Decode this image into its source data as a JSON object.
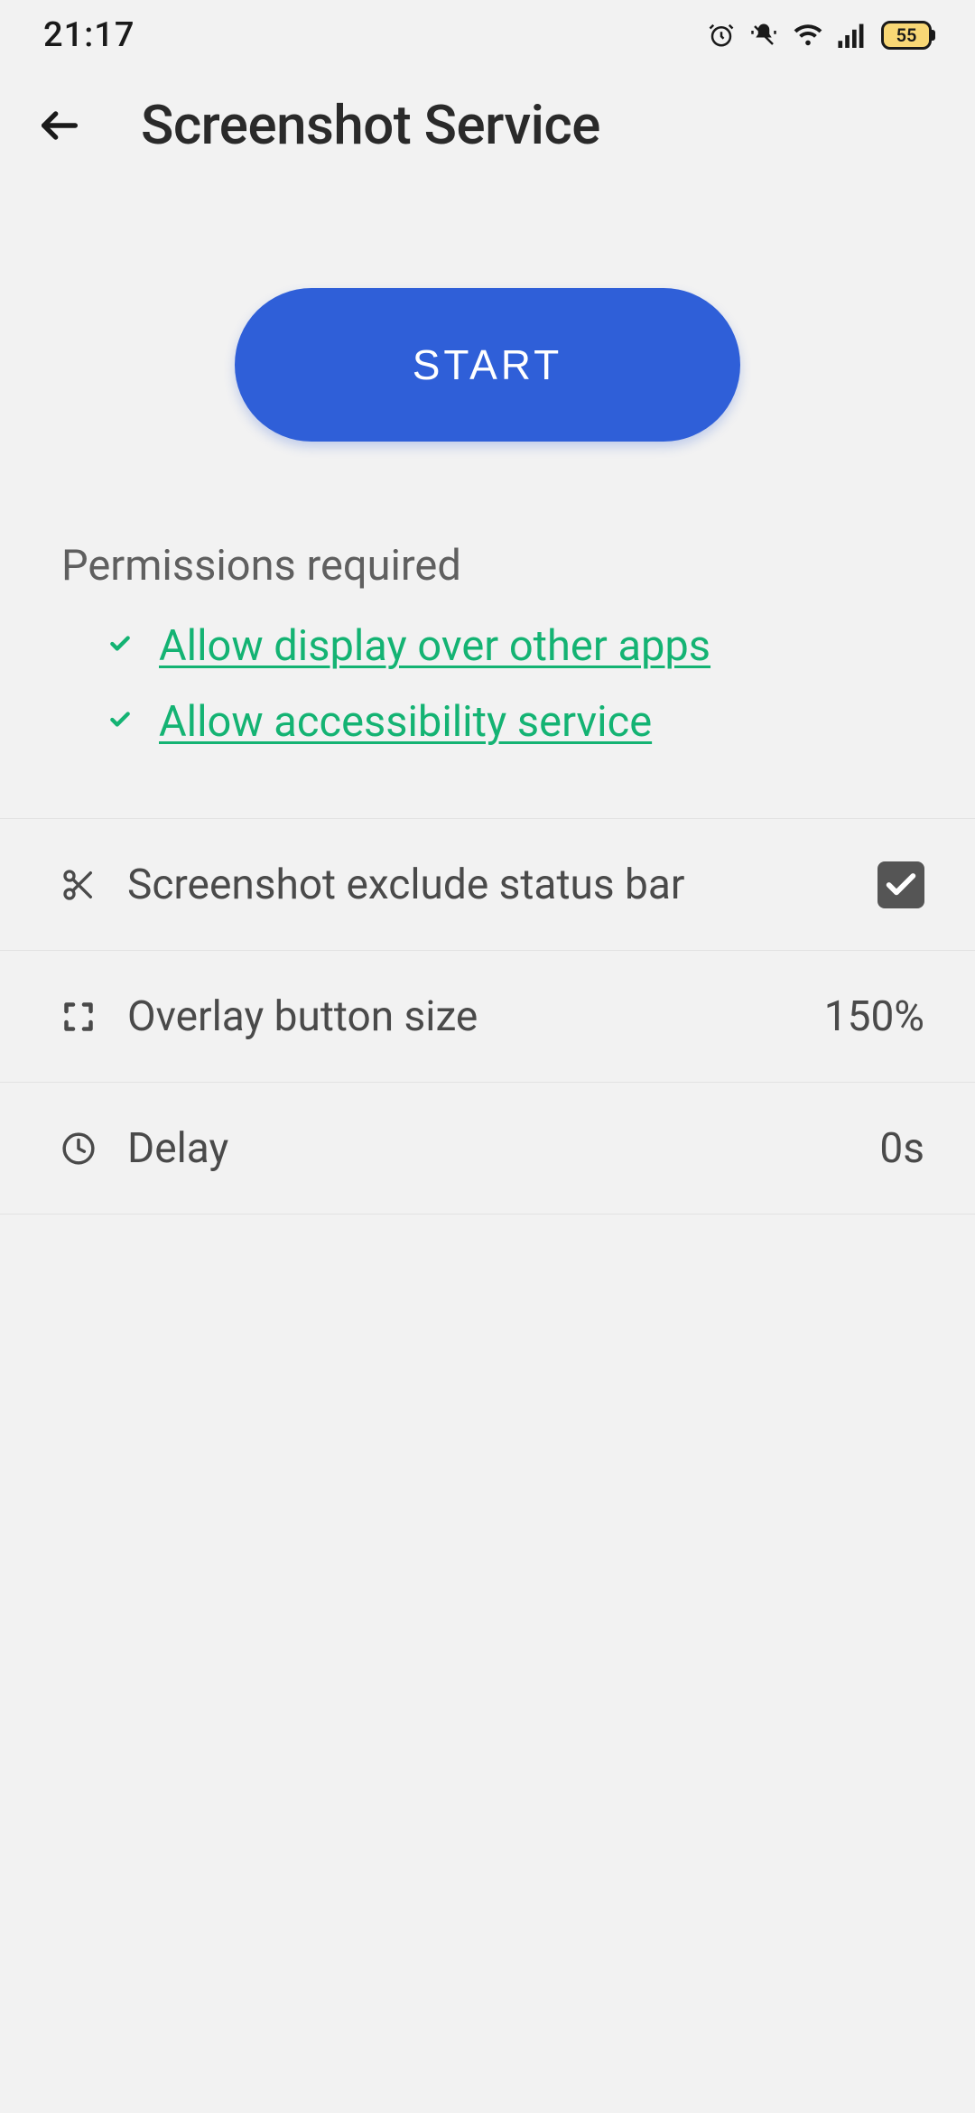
{
  "status": {
    "time": "21:17",
    "battery": "55"
  },
  "header": {
    "title": "Screenshot Service"
  },
  "start": {
    "label": "START"
  },
  "permissions": {
    "heading": "Permissions required",
    "items": [
      {
        "label": "Allow display over other apps"
      },
      {
        "label": "Allow accessibility service"
      }
    ]
  },
  "settings": {
    "exclude_status": {
      "label": "Screenshot exclude status bar",
      "checked": true
    },
    "overlay_size": {
      "label": "Overlay button size",
      "value": "150%"
    },
    "delay": {
      "label": "Delay",
      "value": "0s"
    }
  },
  "colors": {
    "accent": "#2f5fd8",
    "success": "#14b373"
  }
}
